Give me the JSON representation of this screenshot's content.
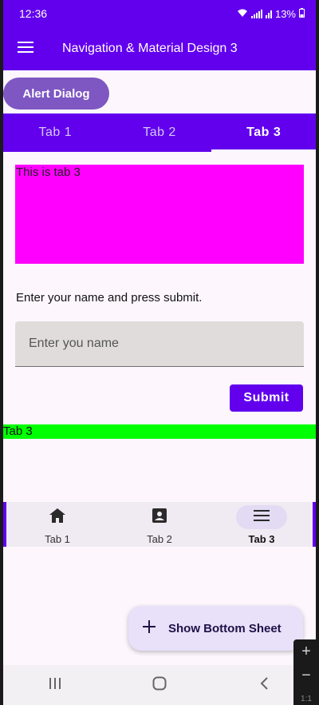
{
  "status_bar": {
    "time": "12:36",
    "battery": "13%"
  },
  "app_bar": {
    "title": "Navigation & Material Design 3",
    "menu_icon": "menu-icon"
  },
  "alert_button": {
    "label": "Alert Dialog"
  },
  "top_tabs": {
    "items": [
      {
        "label": "Tab 1"
      },
      {
        "label": "Tab 2"
      },
      {
        "label": "Tab 3"
      }
    ],
    "selected": "Tab 3"
  },
  "tab_content": {
    "text": "This is tab 3"
  },
  "form": {
    "prompt": "Enter your name and press submit.",
    "name_placeholder": "Enter you name",
    "submit_label": "Submit"
  },
  "green_label": {
    "text": "Tab 3"
  },
  "bottom_nav": {
    "items": [
      {
        "label": "Tab 1",
        "icon": "home-icon"
      },
      {
        "label": "Tab 2",
        "icon": "contact-card-icon"
      },
      {
        "label": "Tab 3",
        "icon": "menu-icon"
      }
    ],
    "selected": "Tab 3"
  },
  "fab": {
    "label": "Show Bottom Sheet",
    "icon": "plus-icon"
  },
  "system_nav": {
    "icons": [
      "recent-apps-icon",
      "home-circle-icon",
      "back-icon"
    ]
  },
  "zoom_overlay": {
    "level": "1:1"
  },
  "colors": {
    "primary": "#6200ee",
    "alert_button": "#7e57c2",
    "tab_box": "#ff00ff",
    "green_label": "#00ff00",
    "fab_container": "#e9e0f9",
    "background": "#fdf7fd"
  }
}
